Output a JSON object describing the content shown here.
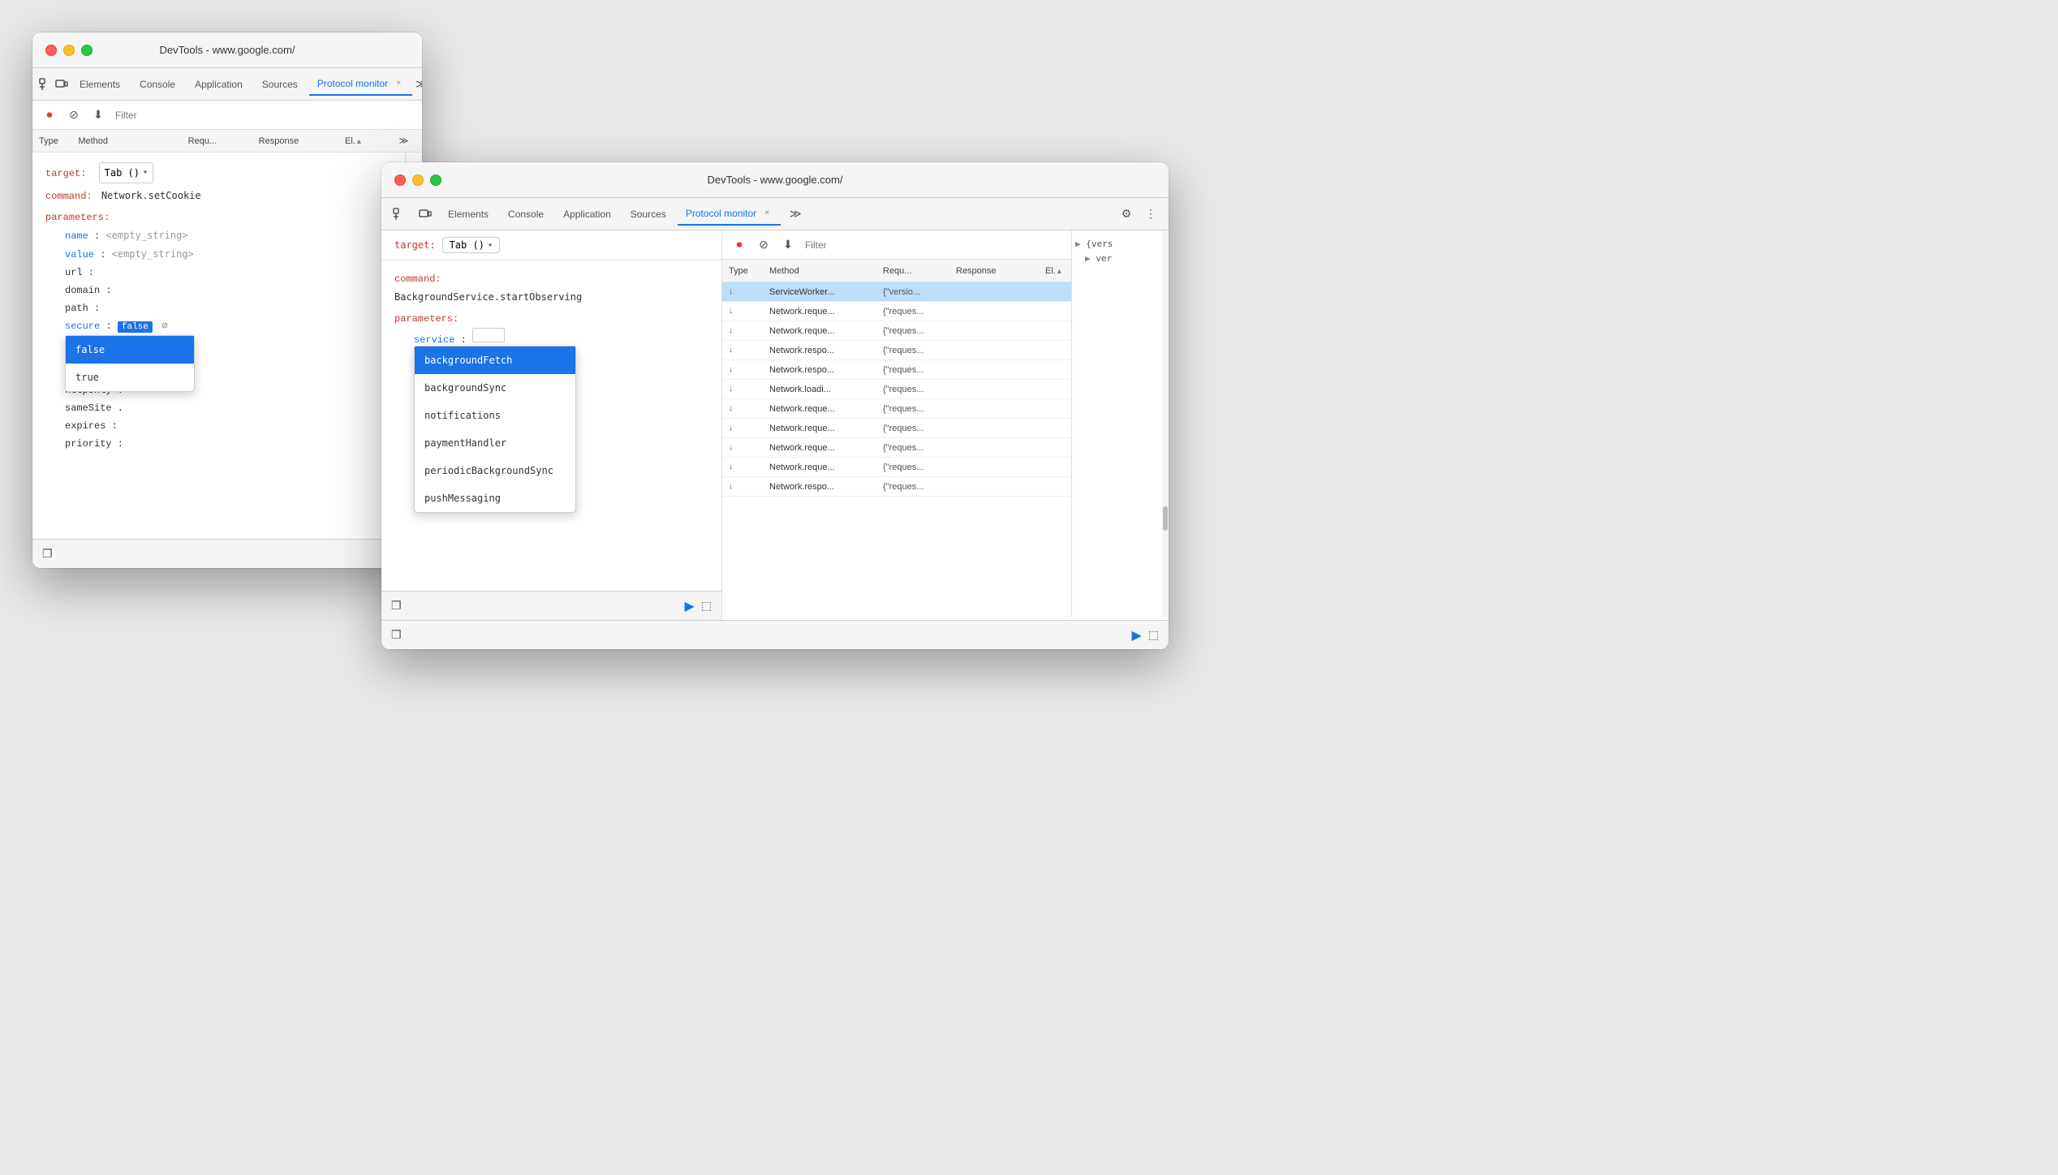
{
  "window1": {
    "title": "DevTools - www.google.com/",
    "tabs": [
      {
        "label": "Elements",
        "active": false
      },
      {
        "label": "Console",
        "active": false
      },
      {
        "label": "Application",
        "active": false
      },
      {
        "label": "Sources",
        "active": false
      },
      {
        "label": "Protocol monitor",
        "active": true
      }
    ],
    "filter_placeholder": "Filter",
    "columns": [
      "Type",
      "Method",
      "Requ...",
      "Response",
      "El.▲"
    ],
    "target_label": "target:",
    "target_value": "Tab ()",
    "command_label": "command:",
    "command_value": "Network.setCookie",
    "parameters_label": "parameters:",
    "params": [
      {
        "key": "name",
        "value": "<empty_string>",
        "indent": 4
      },
      {
        "key": "value",
        "value": "<empty_string>",
        "indent": 4
      },
      {
        "key": "url",
        "value": "",
        "indent": 4
      },
      {
        "key": "domain",
        "value": "",
        "indent": 4
      },
      {
        "key": "path",
        "value": "",
        "indent": 4
      },
      {
        "key": "secure",
        "value": "false",
        "has_dropdown": true,
        "indent": 4
      },
      {
        "key": "httpOnly",
        "value": "",
        "indent": 4
      },
      {
        "key": "sameSite",
        "value": "",
        "indent": 4
      },
      {
        "key": "expires",
        "value": "",
        "indent": 4
      },
      {
        "key": "priority",
        "value": "",
        "indent": 4
      }
    ],
    "bool_dropdown": {
      "selected": "false",
      "options": [
        "false",
        "true"
      ]
    }
  },
  "window2": {
    "title": "DevTools - www.google.com/",
    "tabs": [
      {
        "label": "Elements",
        "active": false
      },
      {
        "label": "Console",
        "active": false
      },
      {
        "label": "Application",
        "active": false
      },
      {
        "label": "Sources",
        "active": false
      },
      {
        "label": "Protocol monitor",
        "active": true
      }
    ],
    "filter_placeholder": "Filter",
    "target_label": "target:",
    "target_value": "Tab ()",
    "command_label": "command:",
    "command_value": "BackgroundService.startObserving",
    "parameters_label": "parameters:",
    "service_param": {
      "key": "service",
      "value": ""
    },
    "service_dropdown": {
      "selected": "backgroundFetch",
      "options": [
        "backgroundFetch",
        "backgroundSync",
        "notifications",
        "paymentHandler",
        "periodicBackgroundSync",
        "pushMessaging"
      ]
    },
    "table": {
      "columns": [
        "Type",
        "Method",
        "Requ...",
        "Response",
        "El.▲"
      ],
      "rows": [
        {
          "type": "↓",
          "method": "ServiceWorker...",
          "requ": "{\"versio...",
          "response": "",
          "highlighted": true
        },
        {
          "type": "↓",
          "method": "Network.reque...",
          "requ": "{\"reques...",
          "response": ""
        },
        {
          "type": "↓",
          "method": "Network.reque...",
          "requ": "{\"reques...",
          "response": ""
        },
        {
          "type": "↓",
          "method": "Network.respo...",
          "requ": "{\"reques...",
          "response": ""
        },
        {
          "type": "↓",
          "method": "Network.respo...",
          "requ": "{\"reques...",
          "response": ""
        },
        {
          "type": "↓",
          "method": "Network.loadi...",
          "requ": "{\"reques...",
          "response": ""
        },
        {
          "type": "↓",
          "method": "Network.reque...",
          "requ": "{\"reques...",
          "response": ""
        },
        {
          "type": "↓",
          "method": "Network.reque...",
          "requ": "{\"reques...",
          "response": ""
        },
        {
          "type": "↓",
          "method": "Network.reque...",
          "requ": "{\"reques...",
          "response": ""
        },
        {
          "type": "↓",
          "method": "Network.reque...",
          "requ": "{\"reques...",
          "response": ""
        },
        {
          "type": "↓",
          "method": "Network.respo...",
          "requ": "{\"reques...",
          "response": ""
        }
      ]
    },
    "detail": {
      "lines": [
        "▶ {vers",
        "  ver"
      ]
    }
  },
  "icons": {
    "stop": "⏹",
    "clear": "⊘",
    "download": "⬇",
    "settings": "⚙",
    "more": "⋮",
    "chevron": "≫",
    "send": "▶",
    "copy": "❐",
    "inspect": "⬚",
    "back": "⌫"
  }
}
